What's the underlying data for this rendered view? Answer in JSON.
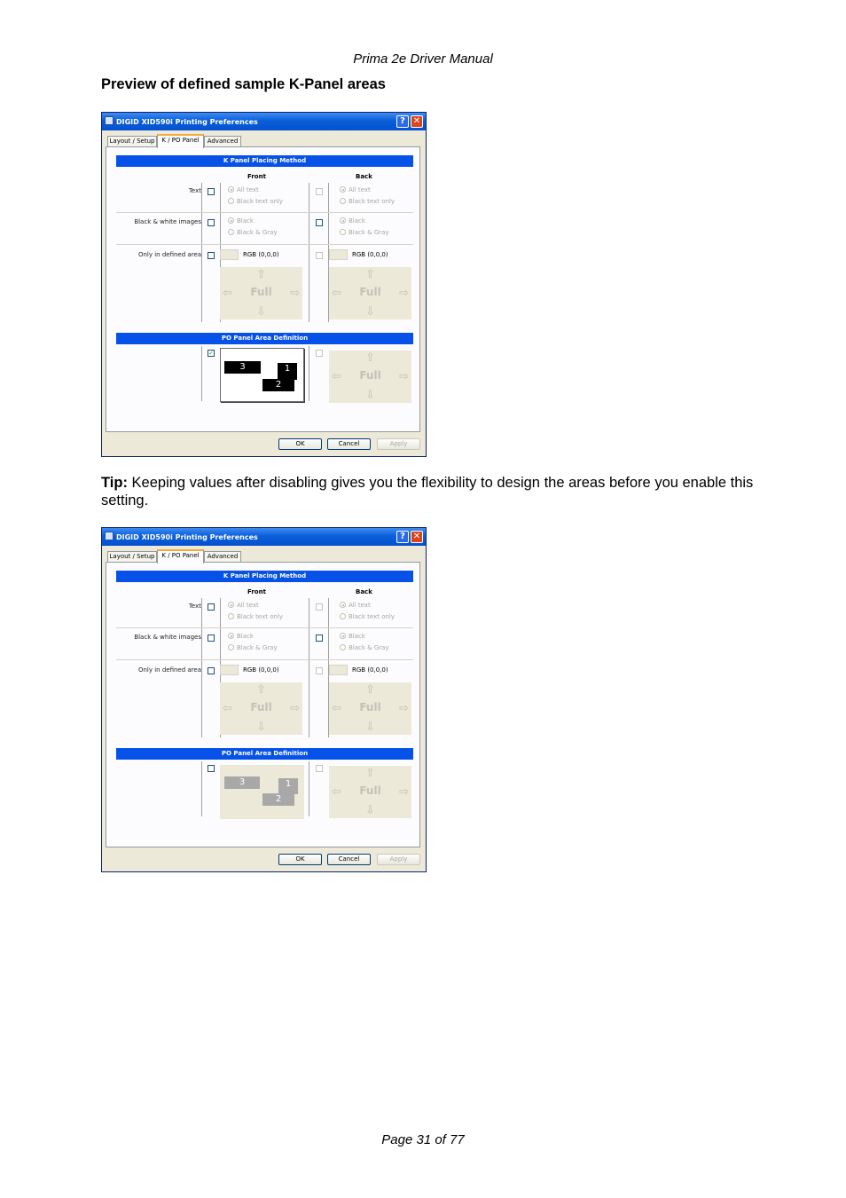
{
  "header": {
    "title": "Prima 2e Driver Manual"
  },
  "section_heading": "Preview of defined sample K-Panel areas",
  "tip": {
    "label": "Tip:",
    "text": " Keeping values after disabling gives you the flexibility to design the areas before you enable this setting."
  },
  "footer": {
    "page": "Page 31 of 77"
  },
  "dialog": {
    "title": "DIGID XID590i Printing Preferences",
    "help_glyph": "?",
    "close_glyph": "✕",
    "tabs": [
      "Layout / Setup",
      "K / PO Panel",
      "Advanced"
    ],
    "k_section": "K Panel Placing Method",
    "front": "Front",
    "back": "Back",
    "rows": {
      "text": "Text",
      "bw": "Black & white images",
      "area": "Only in defined area"
    },
    "options": {
      "all_text": "All text",
      "black_text_only": "Black text only",
      "black": "Black",
      "black_gray": "Black & Gray"
    },
    "rgb": "RGB (0,0,0)",
    "full": "Full",
    "arrows": {
      "up": "⇧",
      "down": "⇩",
      "left": "⇦",
      "right": "⇨"
    },
    "po_section": "PO Panel Area Definition",
    "areas": [
      "3",
      "1",
      "2"
    ],
    "buttons": {
      "ok": "OK",
      "cancel": "Cancel",
      "apply": "Apply"
    }
  },
  "dialog_states": {
    "first": {
      "po_enabled": true,
      "checkmark": "✓"
    },
    "second": {
      "po_enabled": false,
      "checkmark": ""
    }
  }
}
